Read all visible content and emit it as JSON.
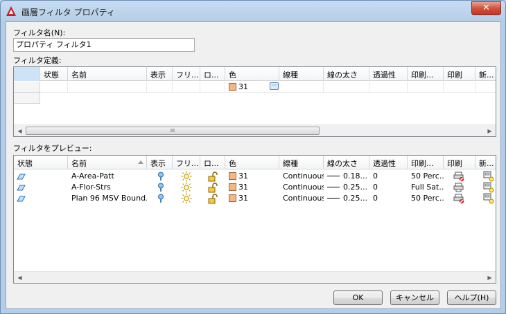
{
  "window": {
    "title": "画層フィルタ プロパティ",
    "close_label": "✕"
  },
  "filter_name": {
    "label": "フィルタ名(N):",
    "value": "プロパティ フィルタ1"
  },
  "filter_definition": {
    "label": "フィルタ定義:",
    "columns": [
      "状態",
      "名前",
      "表示",
      "フリ...",
      "ロ...",
      "色",
      "線種",
      "線の太さ",
      "透過性",
      "印刷...",
      "印刷",
      "新..."
    ],
    "row": {
      "color": "31"
    }
  },
  "preview": {
    "label": "フィルタをプレビュー:",
    "columns": [
      "状態",
      "名前",
      "表示",
      "フリ...",
      "ロ...",
      "色",
      "線種",
      "線の太さ",
      "透過性",
      "印刷...",
      "印刷",
      "新..."
    ],
    "rows": [
      {
        "name": "A-Area-Patt",
        "color": "31",
        "linetype": "Continuous",
        "lineweight": "0.18...",
        "transparency": "0",
        "plot_style": "50 Perc...",
        "plot": "no-plot"
      },
      {
        "name": "A-Flor-Strs",
        "color": "31",
        "linetype": "Continuous",
        "lineweight": "0.25...",
        "transparency": "0",
        "plot_style": "Full Sat...",
        "plot": "plot"
      },
      {
        "name": "Plan 96 MSV Bound...",
        "color": "31",
        "linetype": "Continuous",
        "lineweight": "0.25...",
        "transparency": "0",
        "plot_style": "50 Perc...",
        "plot": "no-plot"
      }
    ]
  },
  "scrollbar": {
    "thumb_grip": "III"
  },
  "buttons": {
    "ok": "OK",
    "cancel": "キャンセル",
    "help": "ヘルプ(H)"
  },
  "colors": {
    "swatch": "#f5b680",
    "title_bg": "#c7dcf2",
    "close": "#c03926"
  }
}
